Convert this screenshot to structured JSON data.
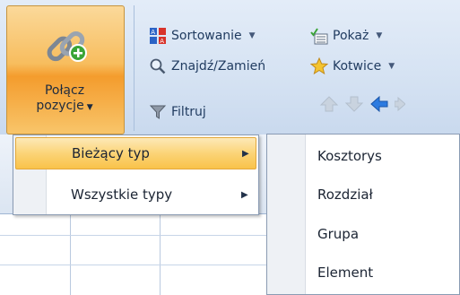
{
  "ribbon": {
    "merge_button": {
      "line1": "Połącz",
      "line2": "pozycje"
    },
    "sort_label": "Sortowanie",
    "find_replace_label": "Znajdź/Zamień",
    "filter_label": "Filtruj",
    "show_label": "Pokaż",
    "anchors_label": "Kotwice"
  },
  "menu": {
    "items": [
      {
        "label": "Bieżący typ",
        "highlighted": true
      },
      {
        "label": "Wszystkie typy",
        "highlighted": false
      }
    ]
  },
  "submenu": {
    "items": [
      {
        "label": "Kosztorys"
      },
      {
        "label": "Rozdział"
      },
      {
        "label": "Grupa"
      },
      {
        "label": "Element"
      }
    ]
  },
  "colors": {
    "highlight": "#f9c34a",
    "ribbon_bg": "#d6e3f3",
    "accent_green": "#3aa537"
  }
}
